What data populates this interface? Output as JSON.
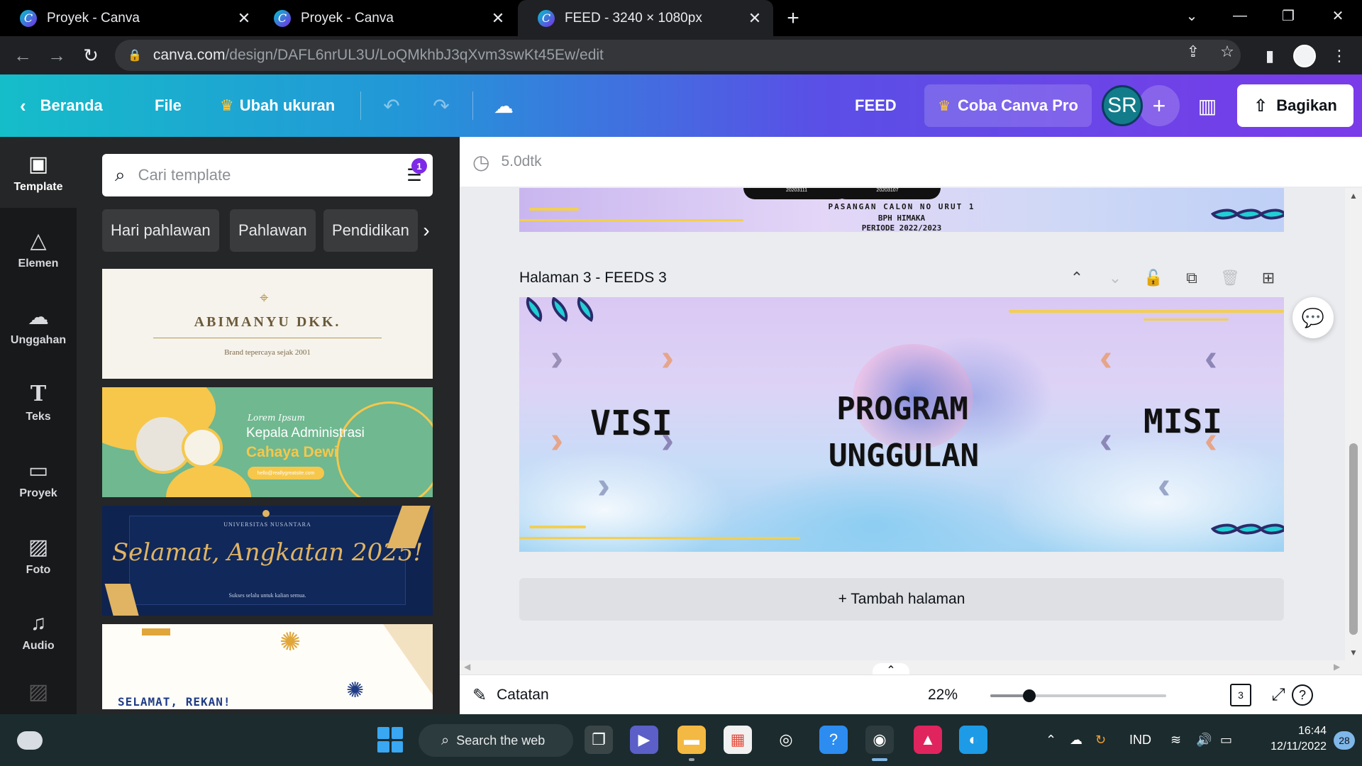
{
  "browser": {
    "tabs": [
      {
        "title": "Proyek - Canva",
        "close": "✕"
      },
      {
        "title": "Proyek - Canva",
        "close": "✕"
      },
      {
        "title": "FEED - 3240 × 1080px",
        "close": "✕"
      }
    ],
    "new_tab": "+",
    "window_controls": {
      "tab_search": "⌄",
      "minimize": "—",
      "restore": "❐",
      "close": "✕"
    },
    "url": {
      "host": "canva.com",
      "path": "/design/DAFL6nrUL3U/LoQMkhbJ3qXvm3swKt45Ew/edit"
    }
  },
  "header": {
    "home_label": "Beranda",
    "file_label": "File",
    "resize_label": "Ubah ukuran",
    "design_title": "FEED",
    "pro_label": "Coba Canva Pro",
    "avatar_initials": "SR",
    "share_label": "Bagikan",
    "colors": {
      "gradient_start": "#15bdc9",
      "gradient_end": "#7a3be8"
    }
  },
  "rail": {
    "items": [
      {
        "label": "Template",
        "icon": "template-icon"
      },
      {
        "label": "Elemen",
        "icon": "elements-icon"
      },
      {
        "label": "Unggahan",
        "icon": "upload-icon"
      },
      {
        "label": "Teks",
        "icon": "text-icon"
      },
      {
        "label": "Proyek",
        "icon": "folder-icon"
      },
      {
        "label": "Foto",
        "icon": "photo-icon"
      },
      {
        "label": "Audio",
        "icon": "audio-icon"
      }
    ]
  },
  "panel": {
    "search_placeholder": "Cari template",
    "filter_count": "1",
    "chips": [
      "Hari pahlawan",
      "Pahlawan",
      "Pendidikan"
    ],
    "templates": {
      "t1": {
        "title": "ABIMANYU DKK.",
        "subtitle": "Brand tepercaya sejak 2001"
      },
      "t2": {
        "small": "Lorem Ipsum",
        "role": "Kepala Administrasi",
        "name": "Cahaya Dewi",
        "email": "hello@reallygreatsite.com"
      },
      "t3": {
        "university": "UNIVERSITAS NUSANTARA",
        "title": "Selamat, Angkatan 2025!",
        "subtitle": "Sukses selalu untuk kalian semua."
      },
      "t4": {
        "title": "SELAMAT, REKAN!"
      }
    }
  },
  "workspace": {
    "save_status": "5.0dtk",
    "page2": {
      "caption1": "PASANGAN CALON NO URUT 1",
      "caption2": "BPH HIMAKA",
      "caption3": "PERIODE 2022/2023",
      "id1": "20203111",
      "id2": "20203107"
    },
    "page_label": "Halaman 3 - FEEDS 3",
    "page3": {
      "left_word": "VISI",
      "center_line1": "PROGRAM",
      "center_line2": "UNGGULAN",
      "right_word": "MISI"
    },
    "add_page_label": "+ Tambah halaman"
  },
  "bottombar": {
    "notes_label": "Catatan",
    "zoom": "22%",
    "zoom_fraction": 0.22,
    "page_count": "3",
    "help": "?"
  },
  "taskbar": {
    "search_label": "Search the web",
    "language": "IND",
    "time": "16:44",
    "date": "12/11/2022",
    "notifications": "28"
  }
}
